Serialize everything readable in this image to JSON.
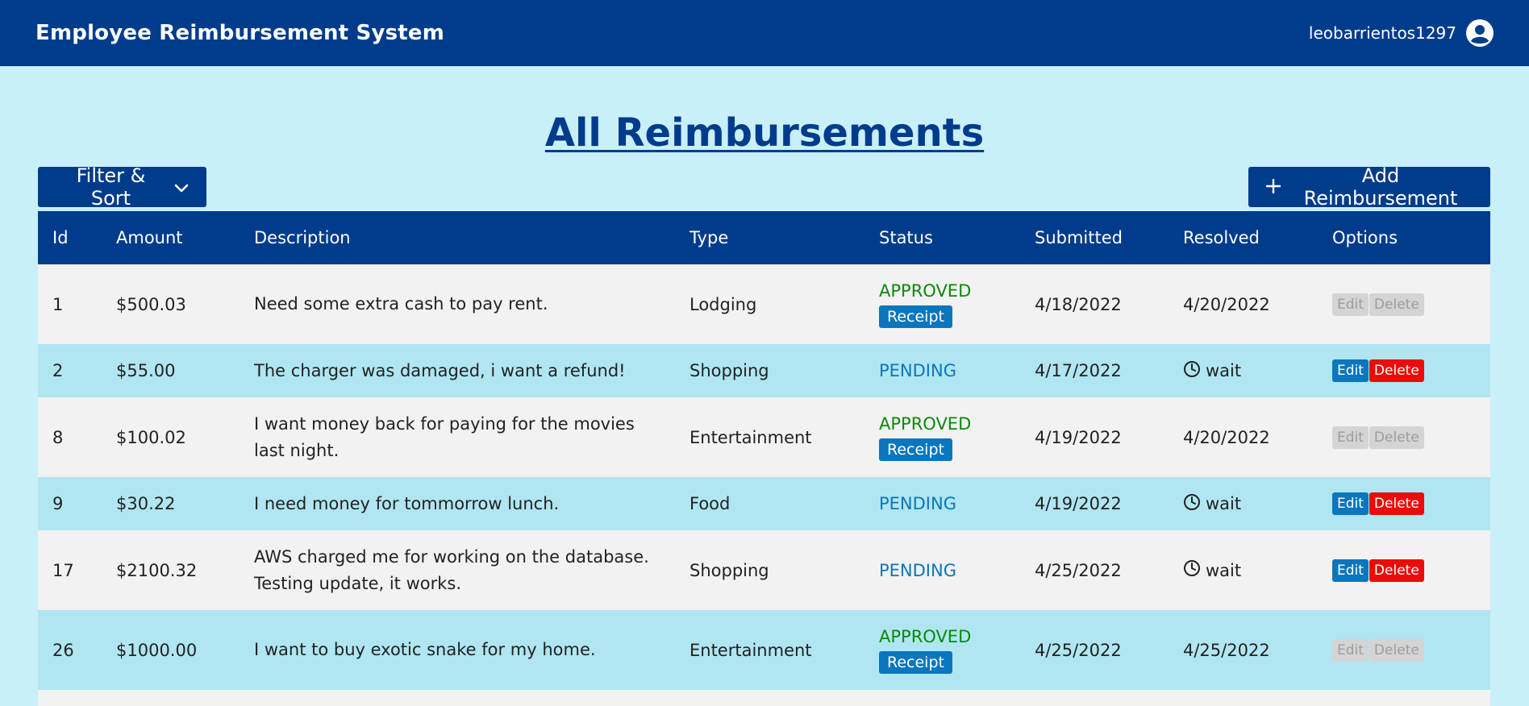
{
  "header": {
    "app_title": "Employee Reimbursement System",
    "username": "leobarrientos1297",
    "brand_color": "#013c8c",
    "background_color": "#c9f0f8"
  },
  "page": {
    "title": "All Reimbursements"
  },
  "toolbar": {
    "filter_label": "Filter & Sort",
    "add_label": "Add Reimbursement"
  },
  "table": {
    "columns": [
      "Id",
      "Amount",
      "Description",
      "Type",
      "Status",
      "Submitted",
      "Resolved",
      "Options"
    ],
    "receipt_label": "Receipt",
    "wait_label": "wait",
    "edit_label": "Edit",
    "delete_label": "Delete",
    "rows": [
      {
        "id": "1",
        "amount": "$500.03",
        "description": "Need some extra cash to pay rent.",
        "type": "Lodging",
        "status": "APPROVED",
        "submitted": "4/18/2022",
        "resolved": "4/20/2022"
      },
      {
        "id": "2",
        "amount": "$55.00",
        "description": "The charger was damaged, i want a refund!",
        "type": "Shopping",
        "status": "PENDING",
        "submitted": "4/17/2022",
        "resolved": "wait"
      },
      {
        "id": "8",
        "amount": "$100.02",
        "description": "I want money back for paying for the movies last night.",
        "type": "Entertainment",
        "status": "APPROVED",
        "submitted": "4/19/2022",
        "resolved": "4/20/2022"
      },
      {
        "id": "9",
        "amount": "$30.22",
        "description": "I need money for tommorrow lunch.",
        "type": "Food",
        "status": "PENDING",
        "submitted": "4/19/2022",
        "resolved": "wait"
      },
      {
        "id": "17",
        "amount": "$2100.32",
        "description": "AWS charged me for working on the database. Testing update, it works.",
        "type": "Shopping",
        "status": "PENDING",
        "submitted": "4/25/2022",
        "resolved": "wait"
      },
      {
        "id": "26",
        "amount": "$1000.00",
        "description": "I want to buy exotic snake for my home.",
        "type": "Entertainment",
        "status": "APPROVED",
        "submitted": "4/25/2022",
        "resolved": "4/25/2022"
      }
    ]
  }
}
